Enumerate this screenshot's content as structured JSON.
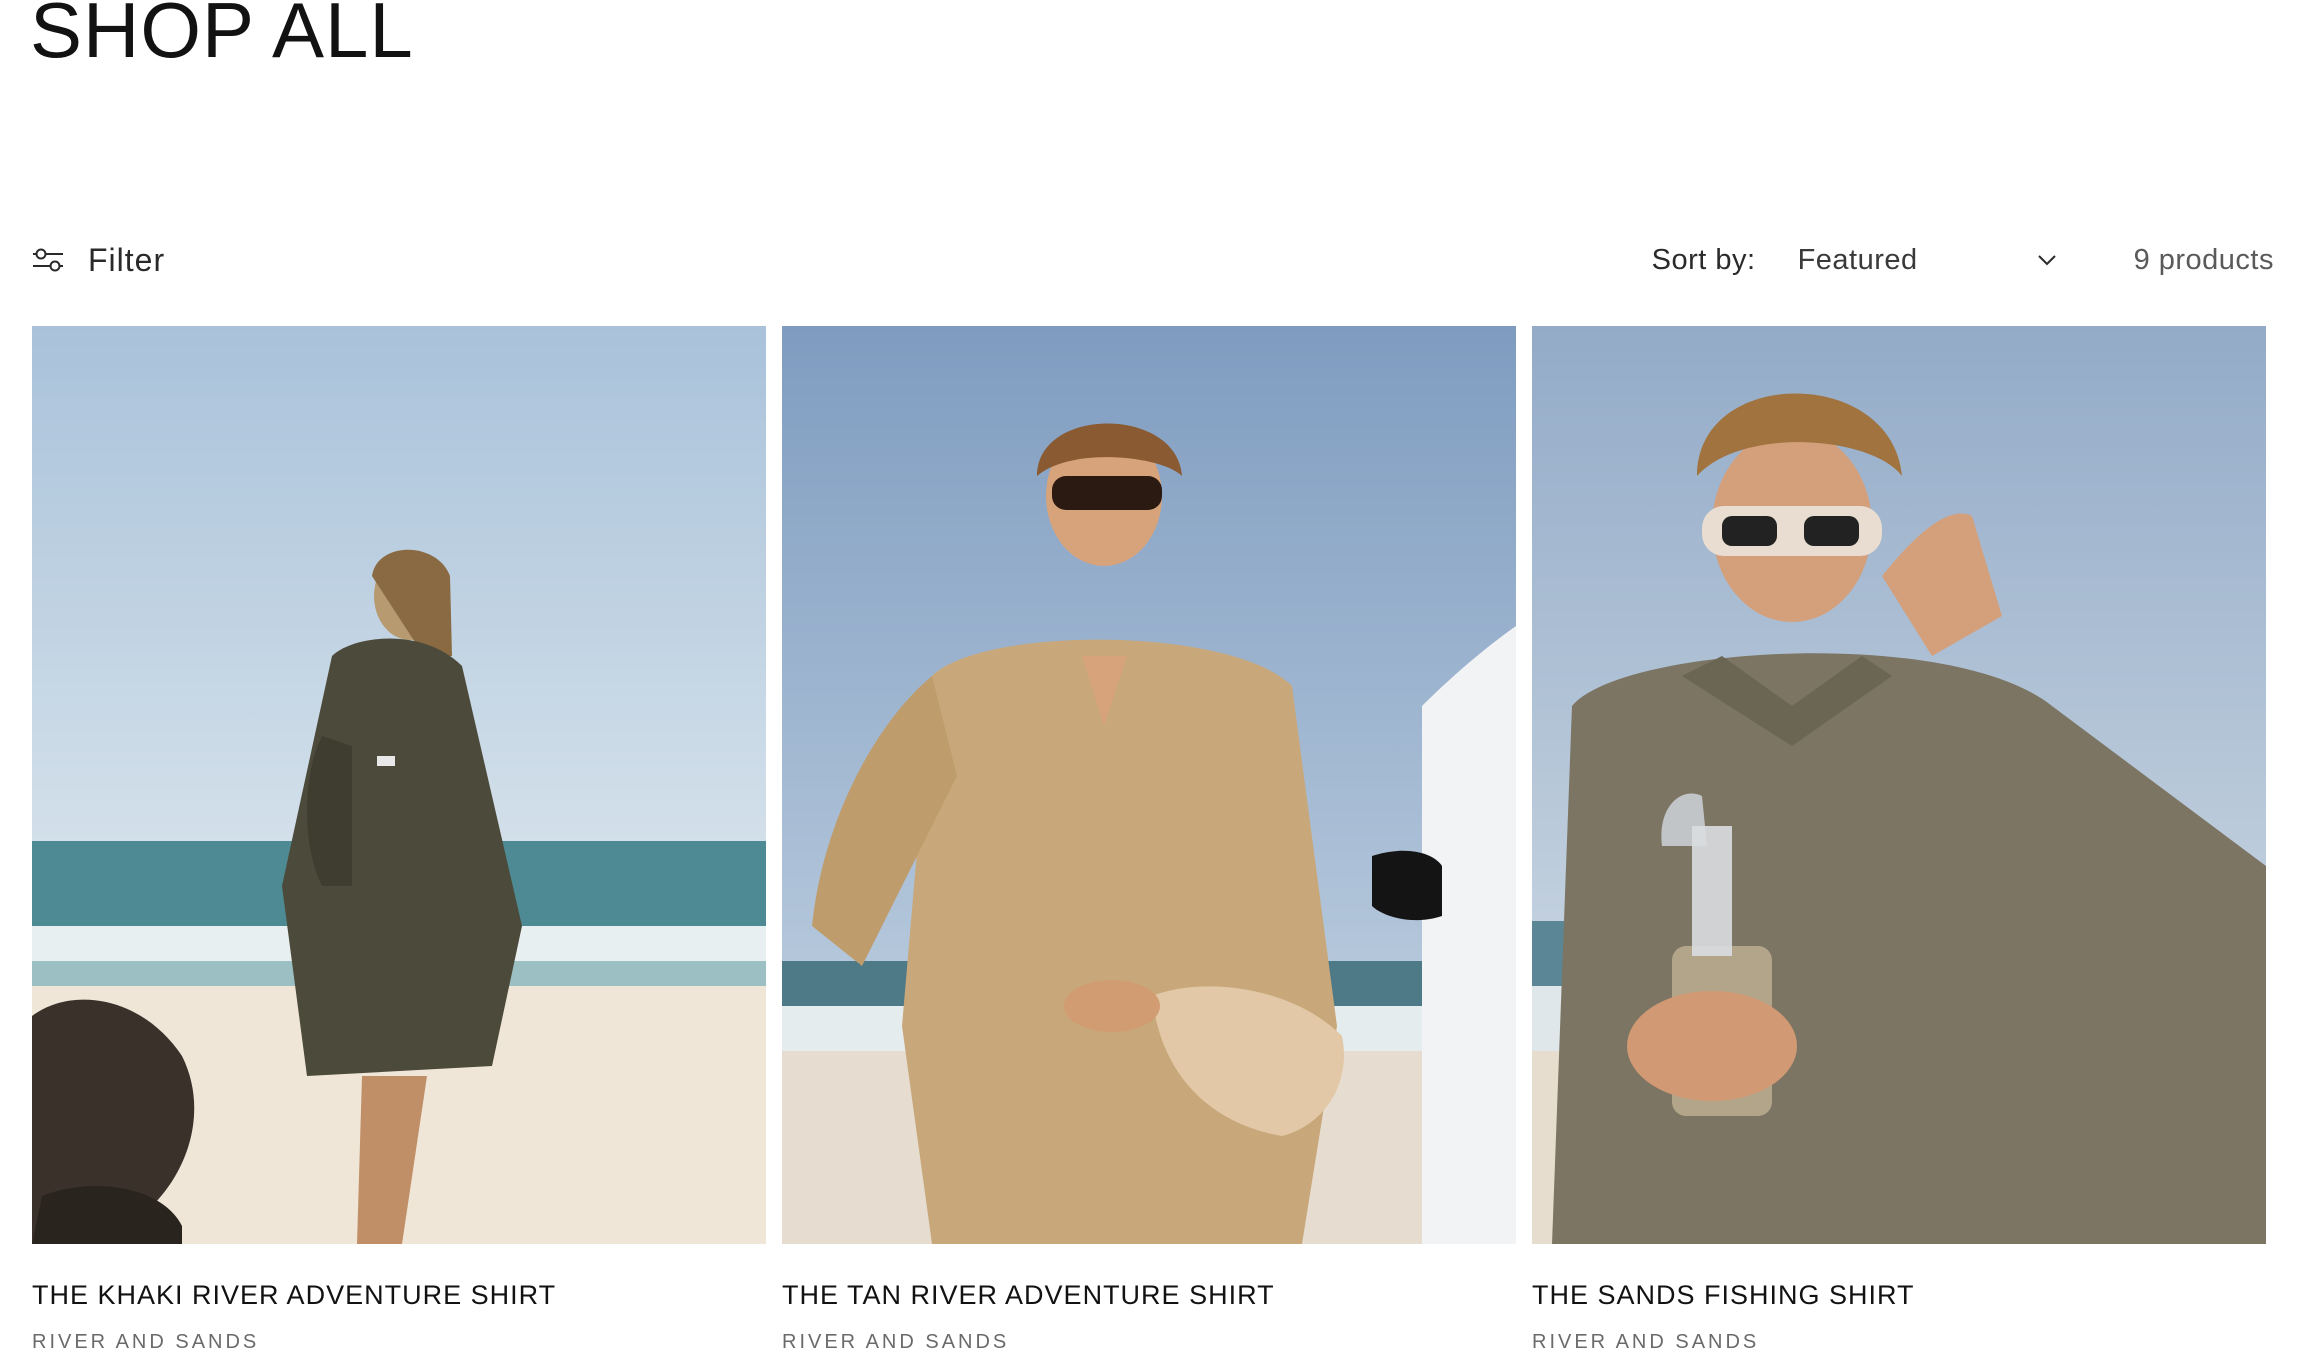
{
  "page": {
    "title": "SHOP ALL"
  },
  "toolbar": {
    "filter_label": "Filter",
    "filter_icon": "sliders-icon",
    "sort_label": "Sort by:",
    "sort_value": "Featured",
    "sort_icon": "chevron-down-icon",
    "product_count": "9 products"
  },
  "products": [
    {
      "title": "THE KHAKI RIVER ADVENTURE SHIRT",
      "vendor": "RIVER AND SANDS",
      "image_description": "woman in khaki shirt on beach",
      "colors": {
        "sky": "#b7cde0",
        "sea": "#4e8a93",
        "sand": "#efe6d8",
        "garment": "#4c4a3a"
      }
    },
    {
      "title": "THE TAN RIVER ADVENTURE SHIRT",
      "vendor": "RIVER AND SANDS",
      "image_description": "man in tan shirt holding cap by white vehicle",
      "colors": {
        "sky": "#8ea9c9",
        "sea": "#4e7a88",
        "sand": "#e6ddd0",
        "garment": "#c8a87a"
      }
    },
    {
      "title": "THE SANDS FISHING SHIRT",
      "vendor": "RIVER AND SANDS",
      "image_description": "man in long sleeve polo holding bottle with sunglasses",
      "colors": {
        "sky": "#a6bbd2",
        "sea": "#5a8696",
        "sand": "#e6ddcf",
        "garment": "#7c7563"
      }
    }
  ]
}
